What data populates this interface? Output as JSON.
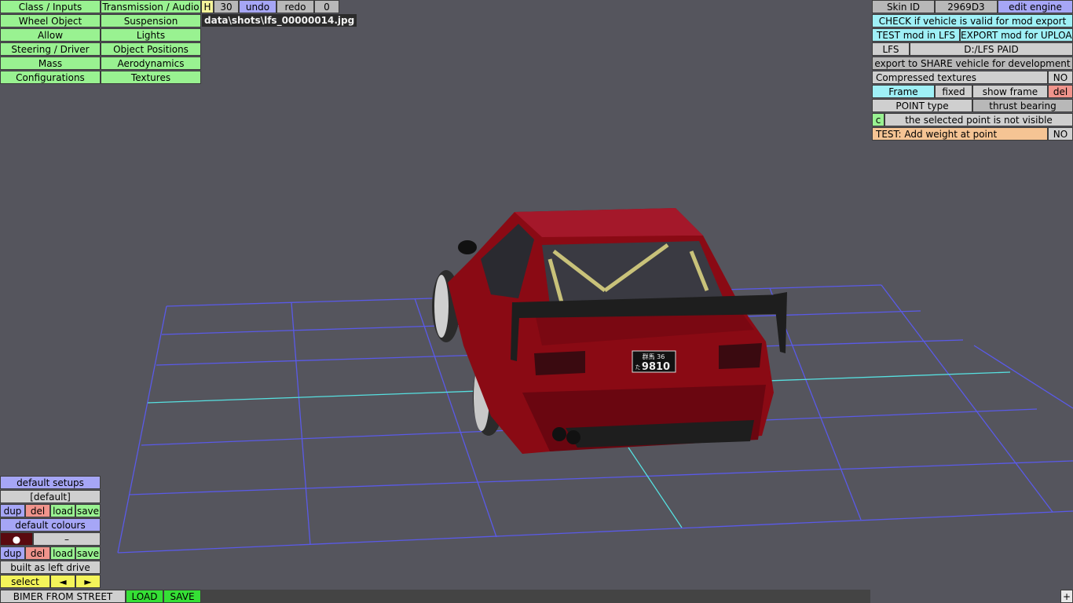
{
  "top_left_menu": {
    "col1": [
      "Class / Inputs",
      "Wheel Object",
      "Allow",
      "Steering / Driver",
      "Mass",
      "Configurations"
    ],
    "col2": [
      "Transmission / Audio",
      "Suspension",
      "Lights",
      "Object Positions",
      "Aerodynamics",
      "Textures"
    ]
  },
  "toolbar": {
    "h": "H",
    "count": "30",
    "undo": "undo",
    "redo": "redo",
    "zero": "0"
  },
  "screenshot_path": "data\\shots\\lfs_00000014.jpg",
  "right_panel": {
    "skin_id_label": "Skin ID",
    "skin_id_value": "2969D3",
    "edit_engine": "edit engine",
    "check_valid": "CHECK if vehicle is valid for mod export",
    "test_mod": "TEST mod in LFS",
    "export_mod": "EXPORT mod for UPLOAD",
    "lfs": "LFS",
    "lfs_path": "D:/LFS PAID",
    "export_share": "export to SHARE vehicle for development",
    "compressed_label": "Compressed textures",
    "compressed_value": "NO",
    "frame": "Frame",
    "fixed": "fixed",
    "show_frame": "show frame",
    "del": "del",
    "point_type": "POINT type",
    "thrust_bearing": "thrust bearing",
    "c": "c",
    "point_not_visible": "the selected point is not visible",
    "test_weight": "TEST: Add weight at point",
    "test_weight_value": "NO"
  },
  "bottom_left": {
    "default_setups": "default setups",
    "default": "[default]",
    "dup": "dup",
    "del": "del",
    "load": "load",
    "save": "save",
    "default_colours": "default colours",
    "colour_dot": "●",
    "colour_dash": "–",
    "built_left": "built as left drive",
    "select": "select",
    "prev": "◄",
    "next": "►"
  },
  "bottom_bar": {
    "vehicle_name": "BIMER FROM STREET",
    "load": "LOAD",
    "save": "SAVE",
    "plus": "+"
  },
  "car": {
    "plate_top": "群馬 36",
    "plate_main": "9810",
    "plate_prefix": "た"
  },
  "colors": {
    "car_body": "#8a0a14",
    "grid_line": "#5a5ae8",
    "grid_axis": "#56e0e0",
    "background": "#55555d"
  }
}
